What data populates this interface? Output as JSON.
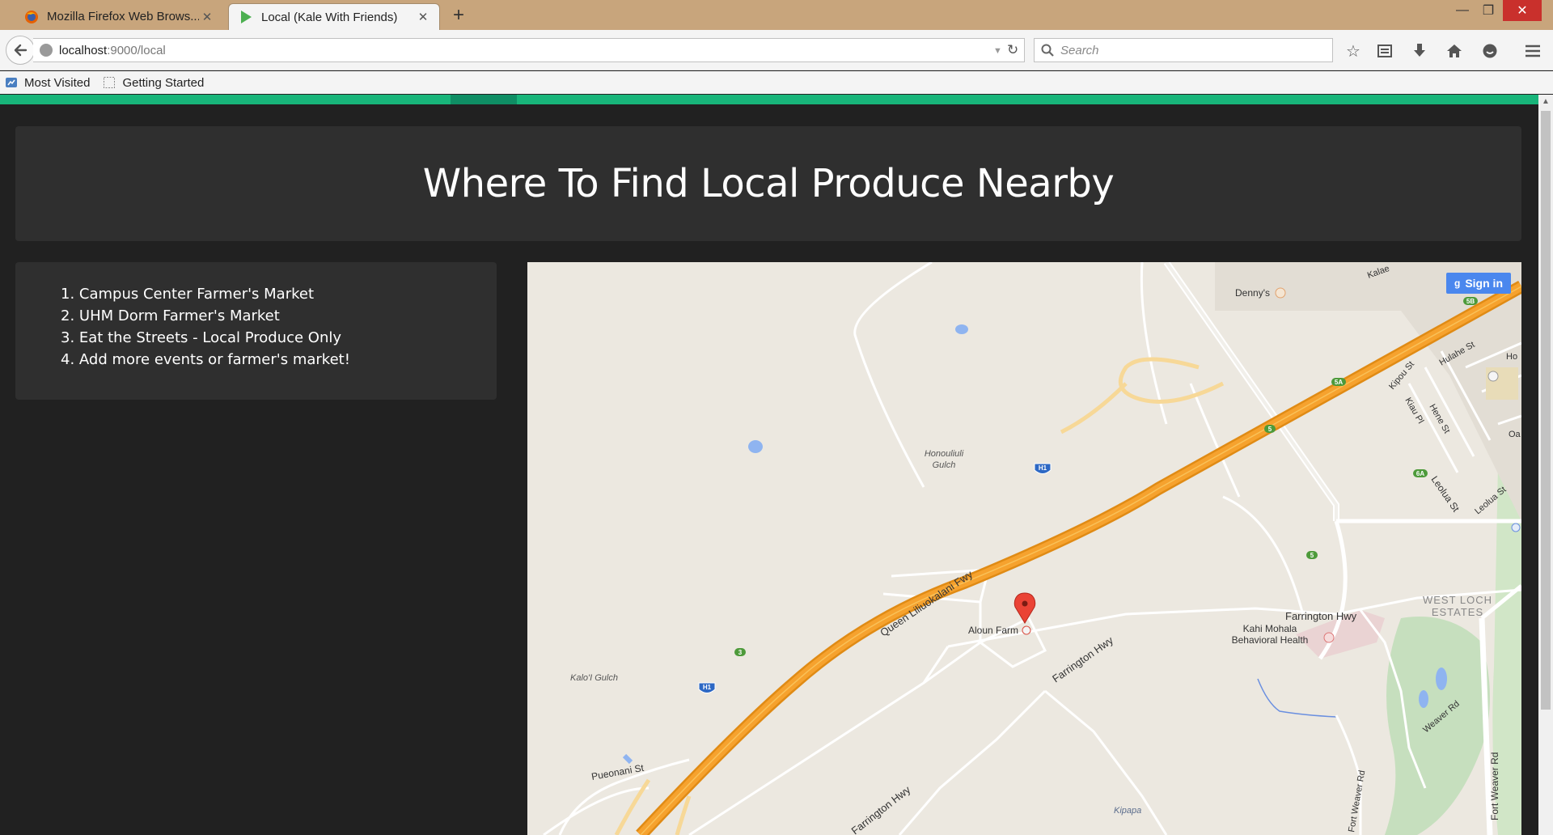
{
  "browser": {
    "tabs": [
      {
        "label": "Mozilla Firefox Web Brows...",
        "icon": "firefox-icon"
      },
      {
        "label": "Local (Kale With Friends)",
        "icon": "play-icon"
      }
    ],
    "address": {
      "host": "localhost",
      "path": ":9000/local"
    },
    "search_placeholder": "Search",
    "bookmarks": [
      {
        "label": "Most Visited"
      },
      {
        "label": "Getting Started"
      }
    ]
  },
  "page": {
    "title": "Where To Find Local Produce Nearby",
    "list": [
      "1. Campus Center Farmer's Market",
      "2. UHM Dorm Farmer's Market",
      "3. Eat the Streets - Local Produce Only",
      "4. Add more events or farmer's market!"
    ]
  },
  "map": {
    "signin_label": "Sign in",
    "marker_label": "Aloun Farm",
    "labels": {
      "freeway": "Queen Liliuokalani Fwy",
      "farrington1": "Farrington Hwy",
      "farrington2": "Farrington Hwy",
      "farrington3": "Farrington Hwy",
      "honouliuli": "Honouliuli",
      "gulch": "Gulch",
      "kaloi": "Kalo'I Gulch",
      "puaonani": "Pueonani St",
      "kipapa": "Kipapa",
      "dennys": "Denny's",
      "kahi1": "Kahi Mohala",
      "kahi2": "Behavioral Health",
      "westloch1": "WEST LOCH",
      "westloch2": "ESTATES",
      "weaver": "Weaver Rd",
      "fortweaver1": "Fort Weaver Rd",
      "fortweaver2": "Fort Weaver Rd",
      "leolua1": "Leolua St",
      "leolua2": "Leolua St",
      "hulahe": "Hulahe St",
      "kipou": "Kipou St",
      "kiau": "Kiau Pl",
      "hene": "Hene St",
      "kalae": "Kalae",
      "ho": "Ho",
      "oa": "Oa",
      "shield_h1a": "H1",
      "shield_h1b": "H1",
      "exit_3": "3",
      "exit_5a": "5",
      "exit_5b": "5",
      "exit_5a2": "5A",
      "exit_5b2": "5B",
      "exit_6a": "6A"
    }
  }
}
